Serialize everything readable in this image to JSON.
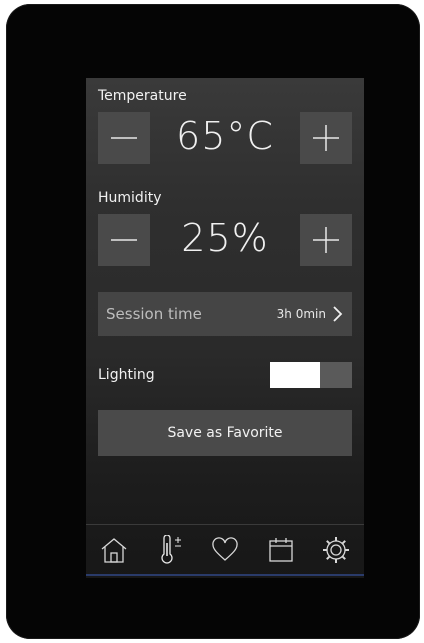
{
  "temperature": {
    "label": "Temperature",
    "value": "65°C"
  },
  "humidity": {
    "label": "Humidity",
    "value": "25%"
  },
  "session": {
    "label": "Session time",
    "value": "3h 0min",
    "chevron": "›"
  },
  "lighting": {
    "label": "Lighting",
    "on": true
  },
  "favorite": {
    "label": "Save as Favorite"
  },
  "nav": {
    "items": [
      {
        "icon": "home-icon"
      },
      {
        "icon": "thermometer-icon"
      },
      {
        "icon": "heart-icon"
      },
      {
        "icon": "calendar-icon"
      },
      {
        "icon": "gear-icon"
      }
    ]
  },
  "colors": {
    "panel": "#4a4a4a",
    "text": "#f2f2f2",
    "accent_line": "#2a3b6a"
  }
}
